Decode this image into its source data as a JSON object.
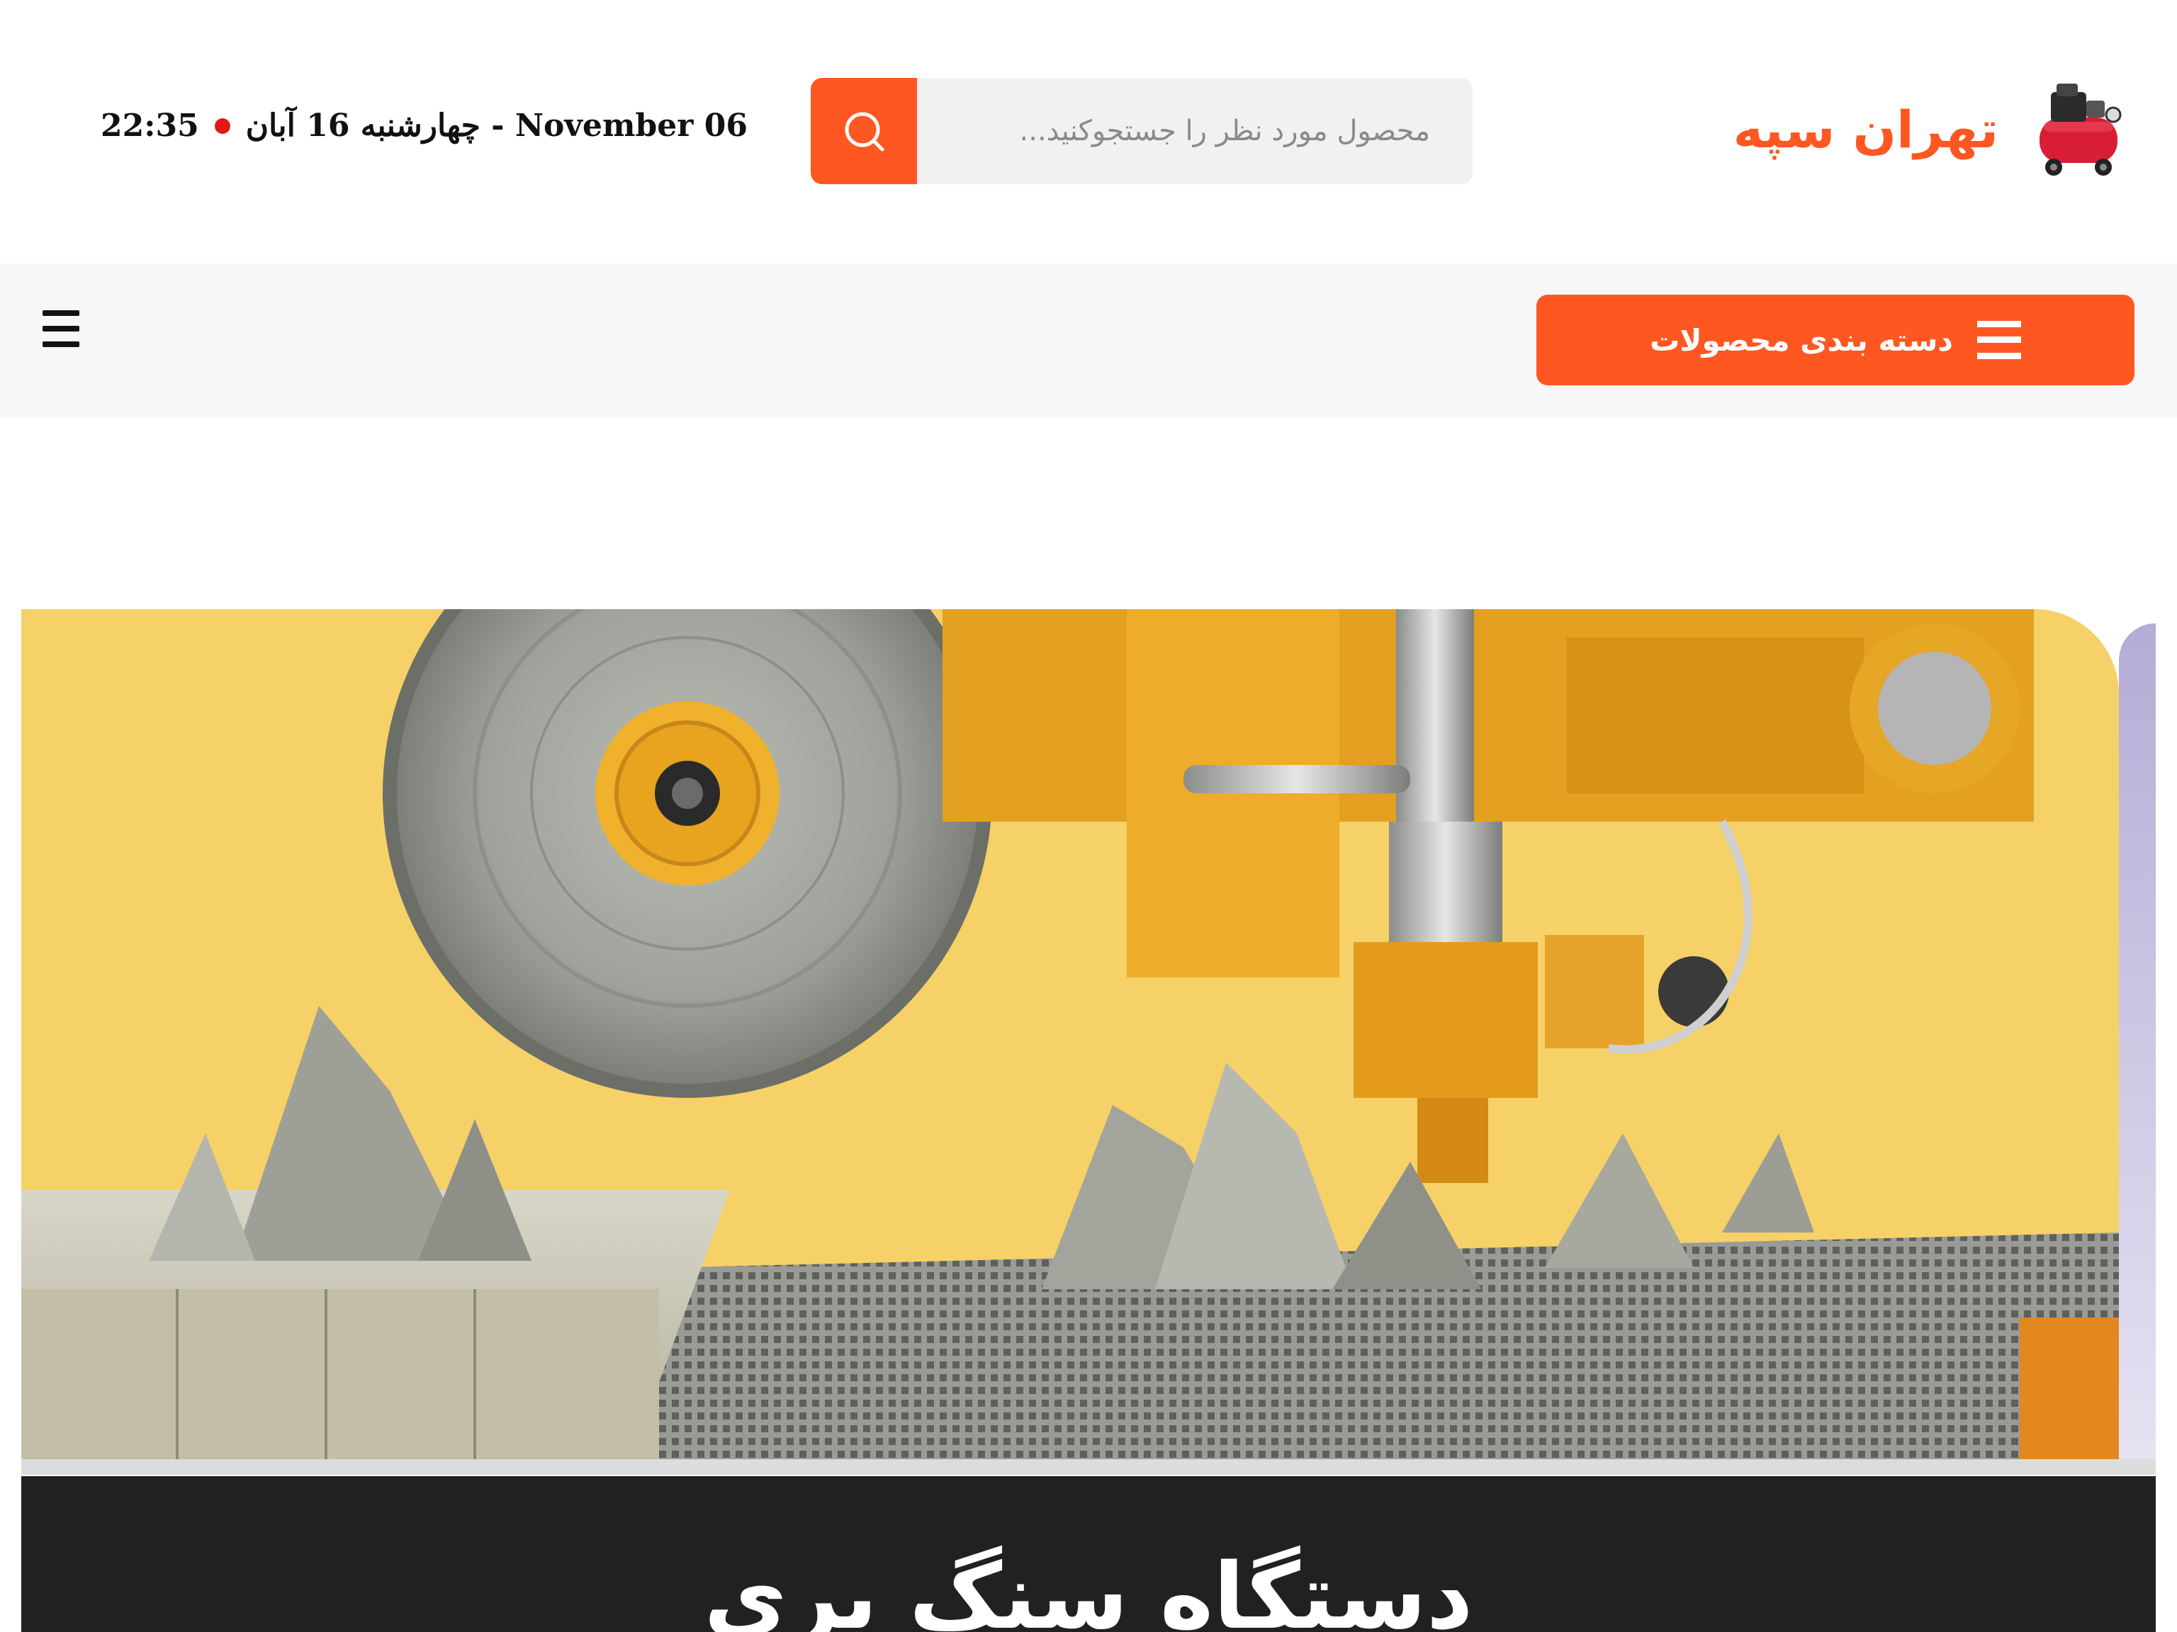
{
  "brand": {
    "name": "تهران سپه",
    "accent_color": "#ff5722",
    "logo_icon": "air-compressor-icon"
  },
  "search": {
    "placeholder": "محصول مورد نظر را جستجوکنید...",
    "button_icon": "search-icon"
  },
  "datetime": {
    "date": "چهارشنبه 16 آبان - November 06",
    "time": "22:35",
    "live_dot_color": "#e11919"
  },
  "nav": {
    "categories_button_label": "دسته بندی محصولات",
    "categories_icon": "menu-icon",
    "mobile_menu_icon": "hamburger-icon"
  },
  "hero": {
    "image_subject": "stone-cutting-machine-image",
    "caption_title": "دستگاه سنگ بری"
  }
}
